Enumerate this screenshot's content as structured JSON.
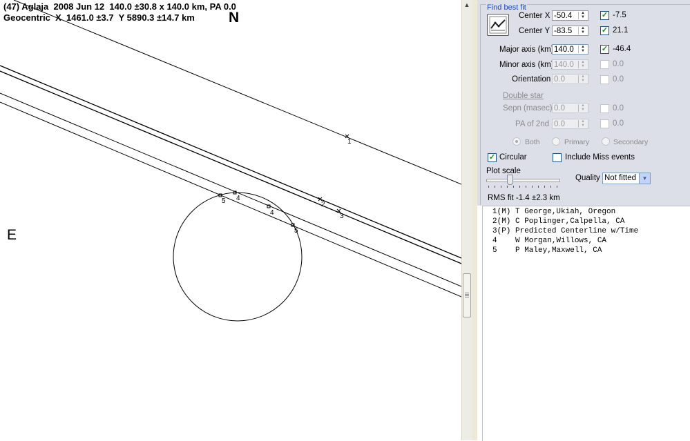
{
  "plot": {
    "header_line1": "(47) Aglaja  2008 Jun 12  140.0 ±30.8 x 140.0 km, PA 0.0",
    "header_line2": "Geocentric  X  1461.0 ±3.7  Y 5890.3 ±14.7 km",
    "compass_north": "N",
    "compass_east": "E",
    "chord_labels": {
      "c1": "1",
      "c2": "2",
      "c3": "3",
      "c4a": "4",
      "c4b": "4",
      "c5a": "5",
      "c5b": "5"
    }
  },
  "panel": {
    "group_title": "Find best fit",
    "center_x": {
      "label": "Center X",
      "value": "-50.4",
      "checked": true,
      "delta": "-7.5"
    },
    "center_y": {
      "label": "Center Y",
      "value": "-83.5",
      "checked": true,
      "delta": "21.1"
    },
    "major_axis": {
      "label": "Major axis (km)",
      "value": "140.0",
      "checked": true,
      "delta": "-46.4"
    },
    "minor_axis": {
      "label": "Minor axis (km)",
      "value": "140.0",
      "checked": false,
      "delta": "0.0"
    },
    "orientation": {
      "label": "Orientation",
      "value": "0.0",
      "checked": false,
      "delta": "0.0"
    },
    "double_star": "Double star",
    "sepn": {
      "label": "Sepn (masec)",
      "value": "0.0",
      "checked": false,
      "delta": "0.0"
    },
    "pa_2nd": {
      "label": "PA of 2nd",
      "value": "0.0",
      "checked": false,
      "delta": "0.0"
    },
    "radio_both": "Both",
    "radio_primary": "Primary",
    "radio_secondary": "Secondary",
    "circular": {
      "label": "Circular",
      "checked": true
    },
    "include_miss": {
      "label": "Include Miss events",
      "checked": false
    },
    "plot_scale": "Plot scale",
    "quality_label": "Quality",
    "quality_value": "Not fitted",
    "rms_fit": "RMS fit -1.4 ±2.3 km"
  },
  "results": [
    "1(M) T George,Ukiah, Oregon",
    "2(M) C Poplinger,Calpella, CA",
    "3(P) Predicted Centerline w/Time",
    "4    W Morgan,Willows, CA",
    "5    P Maley,Maxwell, CA"
  ]
}
